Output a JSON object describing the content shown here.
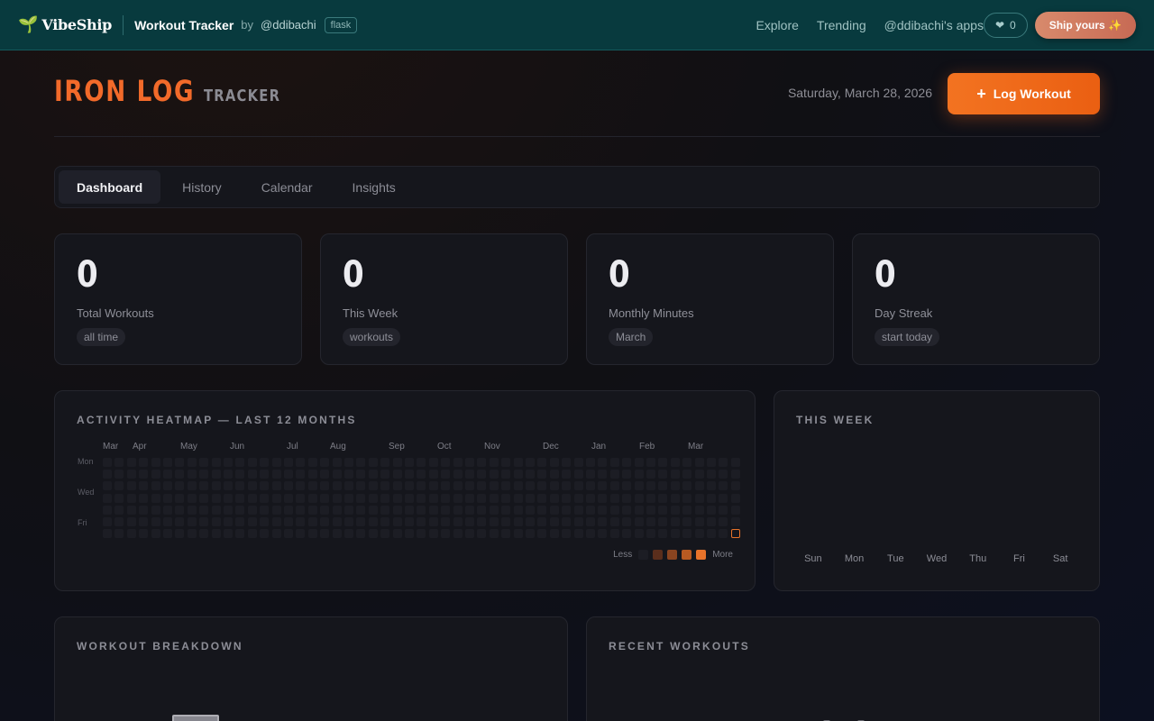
{
  "topbar": {
    "brand": "VibeShip",
    "app_title": "Workout Tracker",
    "by": "by",
    "author": "@ddibachi",
    "tag": "flask",
    "links": [
      "Explore",
      "Trending",
      "@ddibachi's apps"
    ],
    "likes": "0",
    "ship_label": "Ship yours ✨"
  },
  "header": {
    "logo_main": "IRON LOG",
    "logo_sub": "TRACKER",
    "date": "Saturday, March 28, 2026",
    "log_button": "Log Workout"
  },
  "tabs": [
    "Dashboard",
    "History",
    "Calendar",
    "Insights"
  ],
  "active_tab": "Dashboard",
  "stats": [
    {
      "value": "0",
      "label": "Total Workouts",
      "pill": "all time"
    },
    {
      "value": "0",
      "label": "This Week",
      "pill": "workouts"
    },
    {
      "value": "0",
      "label": "Monthly Minutes",
      "pill": "March"
    },
    {
      "value": "0",
      "label": "Day Streak",
      "pill": "start today"
    }
  ],
  "heatmap": {
    "title": "ACTIVITY HEATMAP — LAST 12 MONTHS",
    "months": [
      "Mar",
      "Apr",
      "May",
      "Jun",
      "Jul",
      "Aug",
      "Sep",
      "Oct",
      "Nov",
      "Dec",
      "Jan",
      "Feb",
      "Mar"
    ],
    "days": [
      "Mon",
      "Wed",
      "Fri"
    ],
    "weeks": 53,
    "legend_less": "Less",
    "legend_more": "More",
    "legend_colors": [
      "#1c1d24",
      "#5a2e1c",
      "#8a4420",
      "#b85a22",
      "#e8732a"
    ]
  },
  "this_week": {
    "title": "THIS WEEK",
    "days": [
      "Sun",
      "Mon",
      "Tue",
      "Wed",
      "Thu",
      "Fri",
      "Sat"
    ]
  },
  "breakdown": {
    "title": "WORKOUT BREAKDOWN"
  },
  "recent": {
    "title": "RECENT WORKOUTS"
  }
}
